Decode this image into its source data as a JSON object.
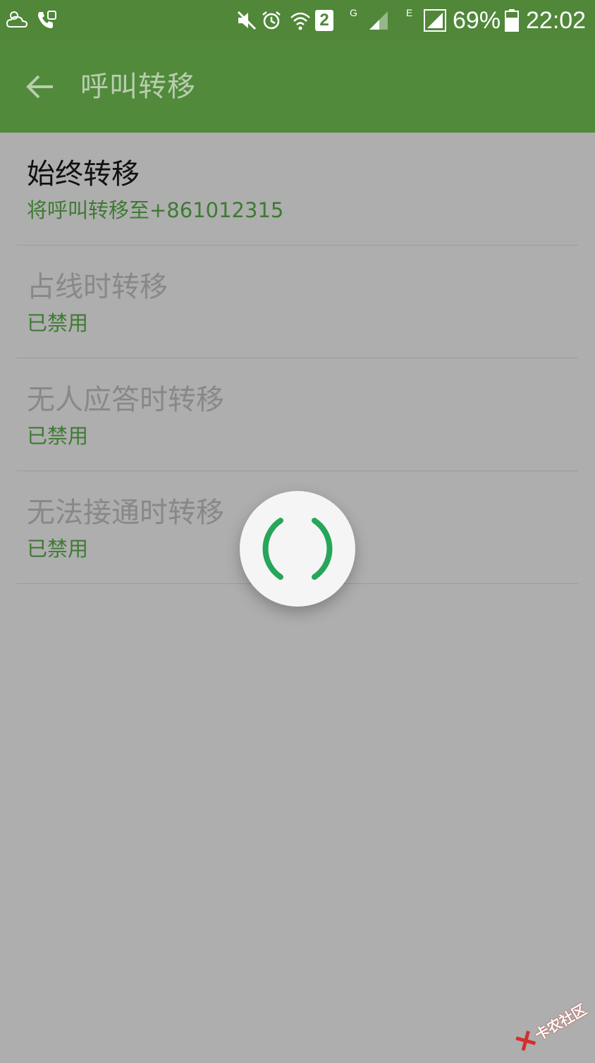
{
  "status_bar": {
    "battery_percent": "69%",
    "time": "22:02",
    "sim_slot": "2",
    "network_g": "G",
    "network_e": "E",
    "icons": [
      "weather-icon",
      "call-forward-icon",
      "mute-icon",
      "alarm-icon",
      "wifi-icon",
      "sim-icon",
      "signal-icon",
      "signal-icon",
      "battery-icon"
    ]
  },
  "app_bar": {
    "title": "呼叫转移",
    "back_icon": "arrow-left-icon"
  },
  "list": {
    "items": [
      {
        "title": "始终转移",
        "summary": "将呼叫转移至+861012315",
        "enabled": true
      },
      {
        "title": "占线时转移",
        "summary": "已禁用",
        "enabled": false
      },
      {
        "title": "无人应答时转移",
        "summary": "已禁用",
        "enabled": false
      },
      {
        "title": "无法接通时转移",
        "summary": "已禁用",
        "enabled": false
      }
    ]
  },
  "spinner": {
    "color": "#27a55a"
  },
  "watermark": {
    "text": "卡农社区"
  },
  "colors": {
    "status_bar": "#508739",
    "app_bar": "#518a3b",
    "scrim": "#aeaeae",
    "summary_green": "#3e7a33"
  }
}
